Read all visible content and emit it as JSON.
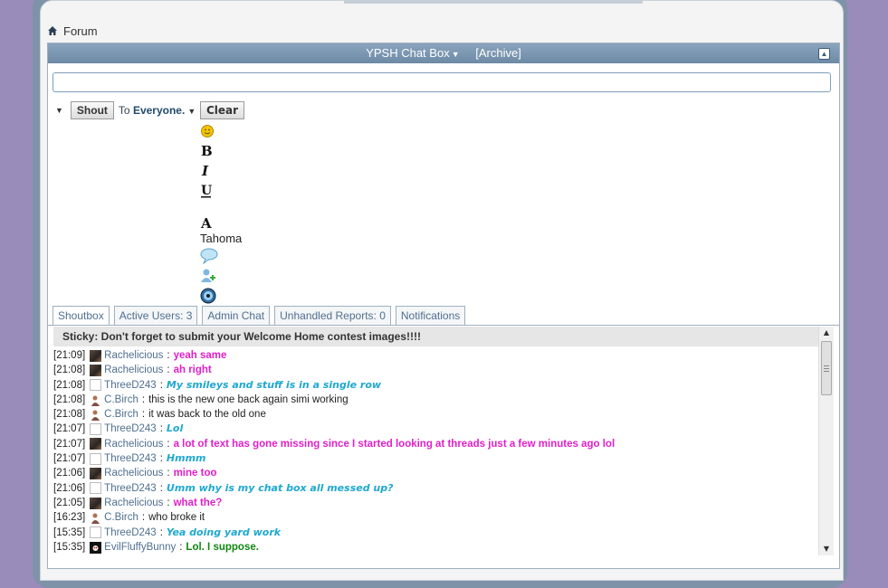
{
  "breadcrumb": {
    "label": "Forum",
    "icon": "home-icon"
  },
  "chat": {
    "title": "YPSH Chat Box",
    "archive": "[Archive]",
    "shout_label": "Shout",
    "to_prefix": "To",
    "to_target": "Everyone.",
    "clear_label": "Clear",
    "font_name": "Tahoma"
  },
  "tabs": [
    {
      "label": "Shoutbox"
    },
    {
      "label": "Active Users: 3"
    },
    {
      "label": "Admin Chat"
    },
    {
      "label": "Unhandled Reports: 0"
    },
    {
      "label": "Notifications"
    }
  ],
  "sticky": "Sticky: Don't forget to submit your Welcome Home contest images!!!!",
  "messages": [
    {
      "time": "[21:09]",
      "user": "Rachelicious",
      "text": "yeah same",
      "style": "pink",
      "avatar": "rach"
    },
    {
      "time": "[21:08]",
      "user": "Rachelicious",
      "text": "ah right",
      "style": "pink",
      "avatar": "rach"
    },
    {
      "time": "[21:08]",
      "user": "ThreeD243",
      "text": "My smileys and stuff is in a single row",
      "style": "cyan",
      "avatar": "three"
    },
    {
      "time": "[21:08]",
      "user": "C.Birch",
      "text": "this is the new one back again simi working",
      "style": "plain",
      "avatar": "cbirch"
    },
    {
      "time": "[21:08]",
      "user": "C.Birch",
      "text": "it was back to the old one",
      "style": "plain",
      "avatar": "cbirch"
    },
    {
      "time": "[21:07]",
      "user": "ThreeD243",
      "text": "Lol",
      "style": "cyan",
      "avatar": "three"
    },
    {
      "time": "[21:07]",
      "user": "Rachelicious",
      "text": "a lot of text has gone missing since I started looking at threads just a few minutes ago lol",
      "style": "pink",
      "avatar": "rach"
    },
    {
      "time": "[21:07]",
      "user": "ThreeD243",
      "text": "Hmmm",
      "style": "cyan",
      "avatar": "three"
    },
    {
      "time": "[21:06]",
      "user": "Rachelicious",
      "text": "mine too",
      "style": "pink",
      "avatar": "rach"
    },
    {
      "time": "[21:06]",
      "user": "ThreeD243",
      "text": "Umm why is my chat box all messed up?",
      "style": "cyan",
      "avatar": "three"
    },
    {
      "time": "[21:05]",
      "user": "Rachelicious",
      "text": "what the?",
      "style": "pink",
      "avatar": "rach"
    },
    {
      "time": "[16:23]",
      "user": "C.Birch",
      "text": "who broke it",
      "style": "plain",
      "avatar": "cbirch"
    },
    {
      "time": "[15:35]",
      "user": "ThreeD243",
      "text": "Yea doing yard work",
      "style": "cyan",
      "avatar": "three"
    },
    {
      "time": "[15:35]",
      "user": "EvilFluffyBunny",
      "text": "Lol. I suppose.",
      "style": "green",
      "avatar": "evil"
    }
  ],
  "colors": {
    "header": "#7a96b1",
    "pink": "#e020c8",
    "cyan": "#1ea8d0",
    "green": "#118811",
    "username": "#4f6f8f"
  }
}
